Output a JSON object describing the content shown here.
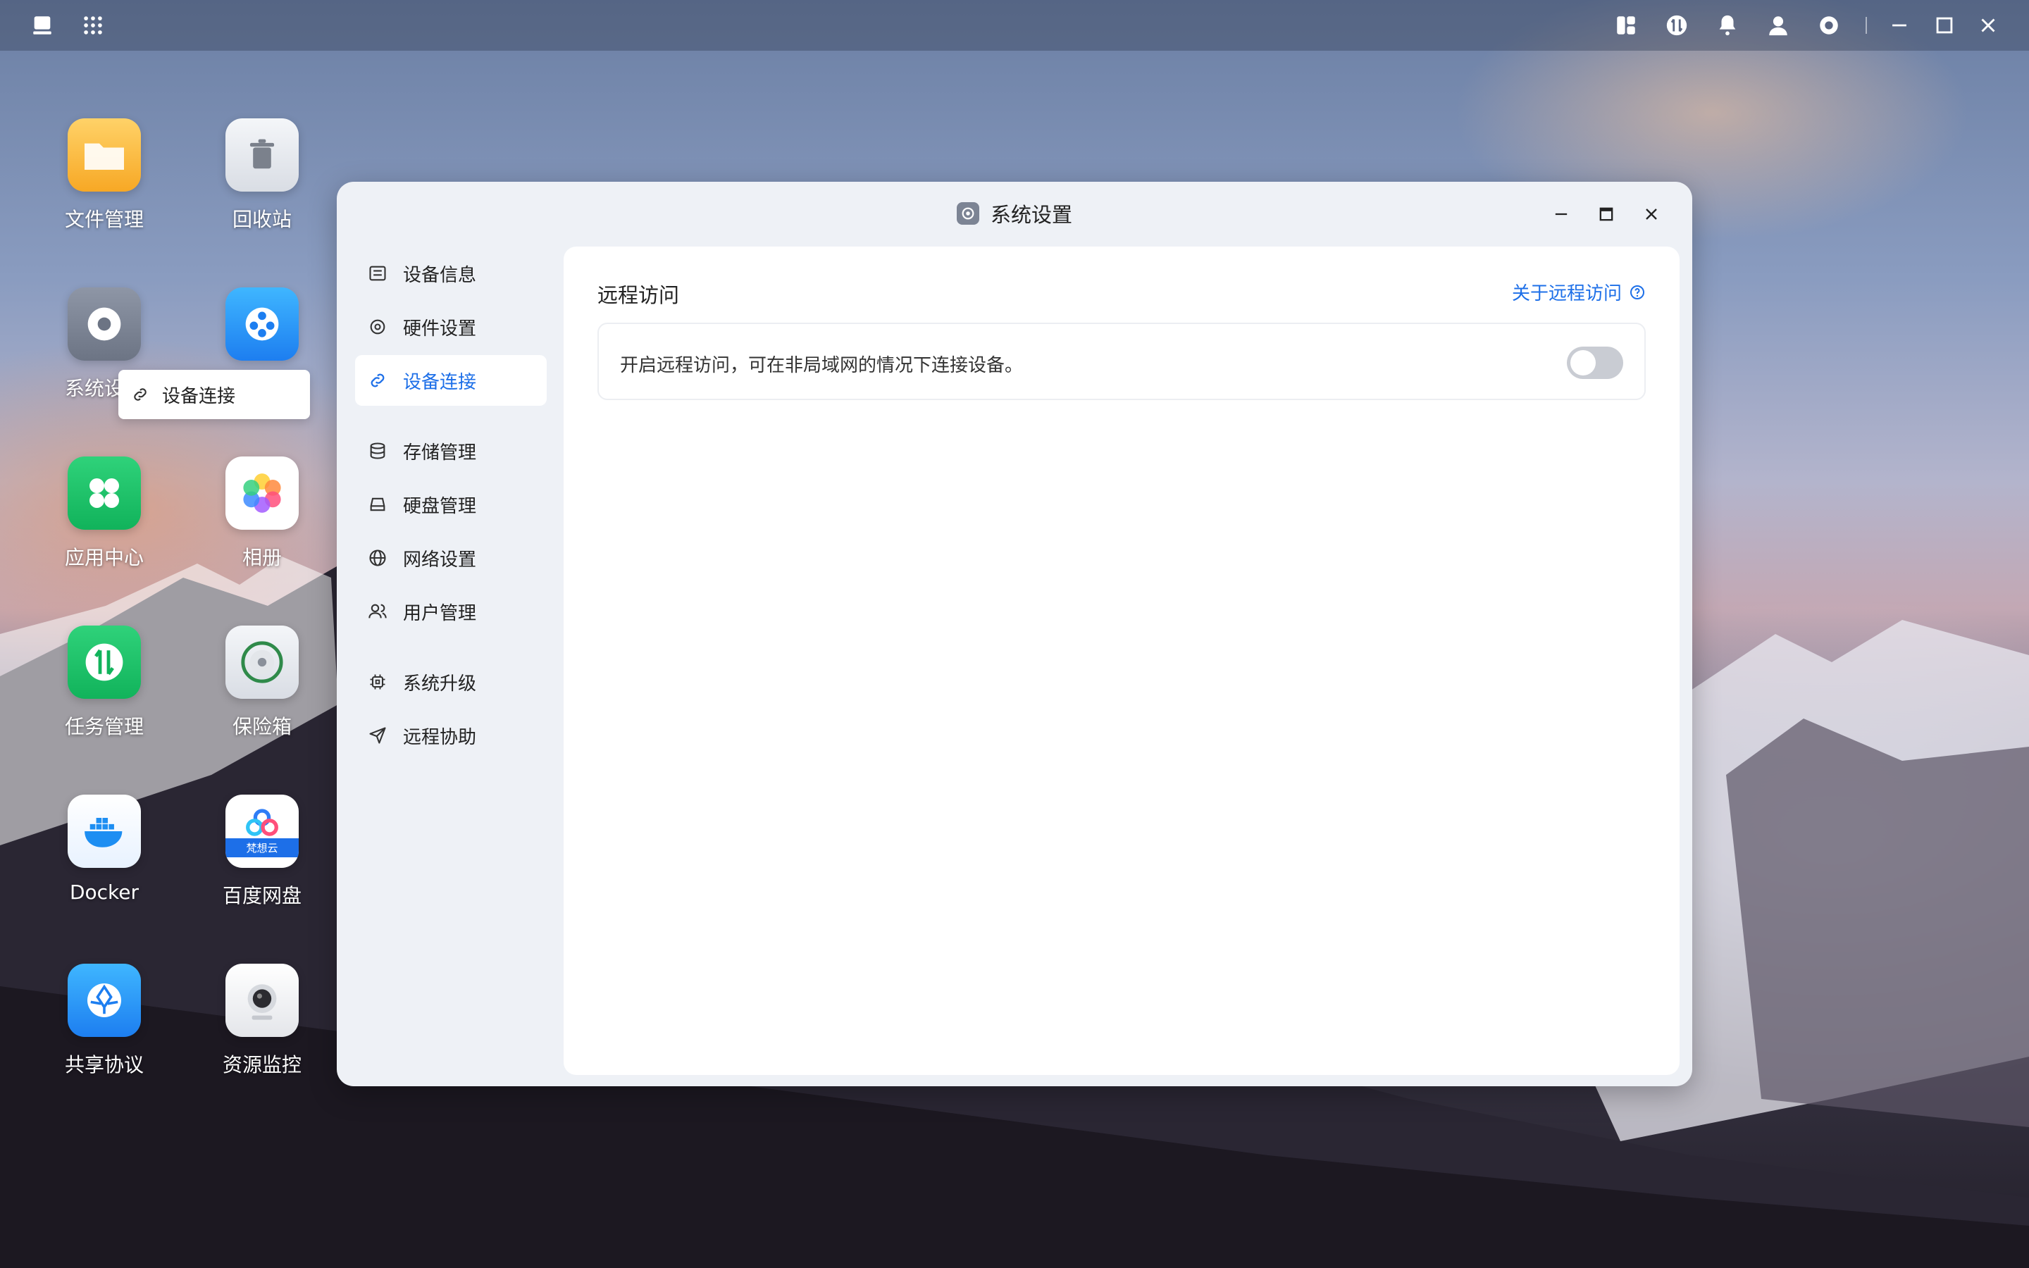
{
  "taskbar": {
    "left_icons": [
      "desktop-icon",
      "app-grid-icon"
    ],
    "right_icons": [
      "widget-icon",
      "task-icon",
      "bell-icon",
      "user-icon",
      "gear-icon"
    ],
    "window_controls": [
      "minimize-icon",
      "maximize-icon",
      "close-icon"
    ]
  },
  "desktop": {
    "icons": [
      {
        "label": "文件管理",
        "icon": "folder-icon"
      },
      {
        "label": "回收站",
        "icon": "trash-icon"
      },
      {
        "label": "系统设",
        "icon": "settings-icon"
      },
      {
        "label": "",
        "icon": "video-icon"
      },
      {
        "label": "应用中心",
        "icon": "app-center-icon"
      },
      {
        "label": "相册",
        "icon": "photos-icon"
      },
      {
        "label": "任务管理",
        "icon": "task-manager-icon"
      },
      {
        "label": "保险箱",
        "icon": "safe-icon"
      },
      {
        "label": "Docker",
        "icon": "docker-icon"
      },
      {
        "label": "百度网盘",
        "icon": "baidu-netdisk-icon"
      },
      {
        "label": "共享协议",
        "icon": "share-protocol-icon"
      },
      {
        "label": "资源监控",
        "icon": "camera-icon"
      }
    ],
    "tooltip": "设备连接",
    "baidu_badge": "梵想云"
  },
  "window": {
    "title": "系统设置",
    "sidebar": [
      {
        "label": "设备信息",
        "icon": "device-info-icon"
      },
      {
        "label": "硬件设置",
        "icon": "hardware-icon"
      },
      {
        "label": "设备连接",
        "icon": "link-icon",
        "active": true
      },
      {
        "label": "存储管理",
        "icon": "storage-icon"
      },
      {
        "label": "硬盘管理",
        "icon": "disk-icon"
      },
      {
        "label": "网络设置",
        "icon": "globe-icon"
      },
      {
        "label": "用户管理",
        "icon": "users-icon"
      },
      {
        "label": "系统升级",
        "icon": "chip-icon"
      },
      {
        "label": "远程协助",
        "icon": "send-icon"
      }
    ],
    "content": {
      "section_title": "远程访问",
      "about_link": "关于远程访问",
      "description": "开启远程访问，可在非局域网的情况下连接设备。",
      "toggle_on": false
    }
  },
  "colors": {
    "accent": "#1d6fe8",
    "toggle_off": "#c9ccd3"
  }
}
